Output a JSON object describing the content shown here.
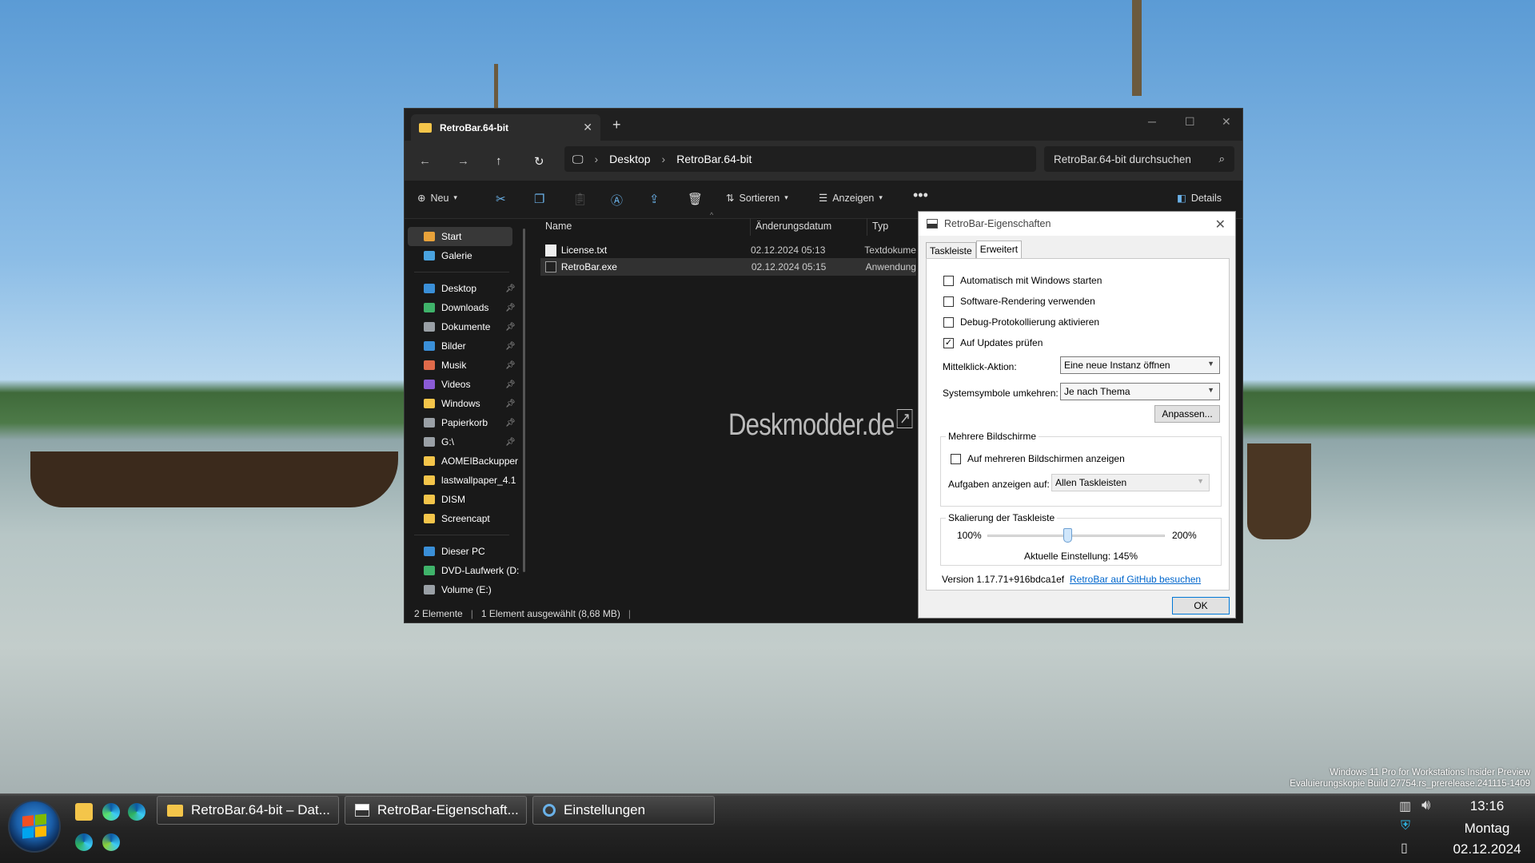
{
  "explorer": {
    "tab_title": "RetroBar.64-bit",
    "breadcrumb": [
      "Desktop",
      "RetroBar.64-bit"
    ],
    "search_placeholder": "RetroBar.64-bit durchsuchen",
    "toolbar": {
      "new": "Neu",
      "sort": "Sortieren",
      "view": "Anzeigen",
      "details": "Details"
    },
    "sidebar": [
      {
        "label": "Start",
        "icon": "home-icon",
        "color": "#e8a23a"
      },
      {
        "label": "Galerie",
        "icon": "gallery-icon",
        "color": "#4aa3df"
      },
      {
        "label": "Desktop",
        "icon": "desktop-icon",
        "color": "#3a8fd8",
        "pinned": true
      },
      {
        "label": "Downloads",
        "icon": "download-icon",
        "color": "#3fb36a",
        "pinned": true
      },
      {
        "label": "Dokumente",
        "icon": "documents-icon",
        "color": "#9aa0a6",
        "pinned": true
      },
      {
        "label": "Bilder",
        "icon": "pictures-icon",
        "color": "#3a8fd8",
        "pinned": true
      },
      {
        "label": "Musik",
        "icon": "music-icon",
        "color": "#e06a4a",
        "pinned": true
      },
      {
        "label": "Videos",
        "icon": "videos-icon",
        "color": "#8a5bd6",
        "pinned": true
      },
      {
        "label": "Windows",
        "icon": "folder-icon",
        "color": "#f4c54a",
        "pinned": true
      },
      {
        "label": "Papierkorb",
        "icon": "recycle-bin-icon",
        "color": "#9aa0a6",
        "pinned": true
      },
      {
        "label": "G:\\",
        "icon": "drive-icon",
        "color": "#9aa0a6",
        "pinned": true
      },
      {
        "label": "AOMEIBackupper",
        "icon": "folder-icon",
        "color": "#f4c54a"
      },
      {
        "label": "lastwallpaper_4.1",
        "icon": "folder-icon",
        "color": "#f4c54a"
      },
      {
        "label": "DISM",
        "icon": "folder-icon",
        "color": "#f4c54a"
      },
      {
        "label": "Screencapt",
        "icon": "folder-icon",
        "color": "#f4c54a"
      },
      {
        "label": "Dieser PC",
        "icon": "this-pc-icon",
        "color": "#3a8fd8"
      },
      {
        "label": "DVD-Laufwerk (D:",
        "icon": "dvd-icon",
        "color": "#3fb36a"
      },
      {
        "label": "Volume (E:)",
        "icon": "drive-icon",
        "color": "#9aa0a6"
      }
    ],
    "columns": {
      "name": "Name",
      "date": "Änderungsdatum",
      "type": "Typ"
    },
    "files": [
      {
        "name": "License.txt",
        "date": "02.12.2024 05:13",
        "type": "Textdokume"
      },
      {
        "name": "RetroBar.exe",
        "date": "02.12.2024 05:15",
        "type": "Anwendung"
      }
    ],
    "status": {
      "count": "2 Elemente",
      "selection": "1 Element ausgewählt (8,68 MB)"
    },
    "watermark": "Deskmodder.de"
  },
  "dialog": {
    "title": "RetroBar-Eigenschaften",
    "tabs": [
      "Taskleiste",
      "Erweitert"
    ],
    "checkboxes": [
      {
        "label": "Automatisch mit Windows starten",
        "checked": false
      },
      {
        "label": "Software-Rendering verwenden",
        "checked": false
      },
      {
        "label": "Debug-Protokollierung aktivieren",
        "checked": false
      },
      {
        "label": "Auf Updates prüfen",
        "checked": true
      }
    ],
    "middle_click_label": "Mittelklick-Aktion:",
    "middle_click_value": "Eine neue Instanz öffnen",
    "tray_invert_label": "Systemsymbole umkehren:",
    "tray_invert_value": "Je nach Thema",
    "customize_button": "Anpassen...",
    "multi_monitor": {
      "group_title": "Mehrere Bildschirme",
      "show_all_label": "Auf mehreren Bildschirmen anzeigen",
      "show_tasks_label": "Aufgaben anzeigen auf:",
      "show_tasks_value": "Allen Taskleisten"
    },
    "scaling": {
      "group_title": "Skalierung der Taskleiste",
      "min": "100%",
      "max": "200%",
      "value": 145,
      "current": "Aktuelle Einstellung: 145%"
    },
    "version": "Version 1.17.71+916bdca1ef",
    "github_link": "RetroBar auf GitHub besuchen",
    "ok_button": "OK"
  },
  "taskbar": {
    "tasks": [
      {
        "label": "RetroBar.64-bit – Dat...",
        "icon": "folder-icon"
      },
      {
        "label": "RetroBar-Eigenschaft...",
        "icon": "retrobar-icon"
      },
      {
        "label": "Einstellungen",
        "icon": "settings-icon"
      }
    ],
    "time": "13:16",
    "day": "Montag",
    "date": "02.12.2024"
  },
  "system_info": {
    "line1": "Windows 11 Pro for Workstations Insider Preview",
    "line2": "Evaluierungskopie Build 27754.rs_prerelease.241115-1409"
  }
}
